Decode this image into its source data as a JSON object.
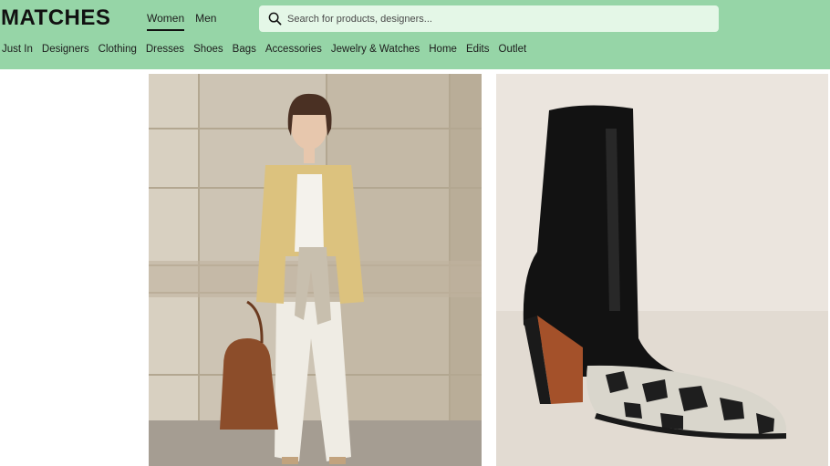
{
  "brand": {
    "logo": "MATCHES"
  },
  "gender_tabs": [
    {
      "label": "Women",
      "active": true
    },
    {
      "label": "Men",
      "active": false
    }
  ],
  "search": {
    "placeholder": "Search for products, designers..."
  },
  "nav": {
    "items": [
      "Just In",
      "Designers",
      "Clothing",
      "Dresses",
      "Shoes",
      "Bags",
      "Accessories",
      "Jewelry & Watches",
      "Home",
      "Edits",
      "Outlet"
    ]
  },
  "colors": {
    "header_bg": "#96d5a7",
    "search_bg": "#e4f7e7",
    "text": "#1d1d1d"
  },
  "icons": {
    "search": "search-icon"
  }
}
